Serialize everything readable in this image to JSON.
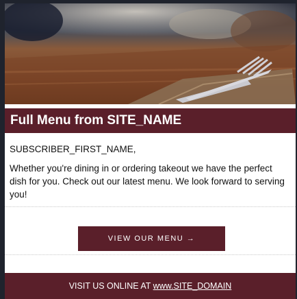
{
  "email": {
    "hero": {
      "alt": "table with fork and knife on napkin"
    },
    "banner_title": "Full Menu from SITE_NAME",
    "greeting": "SUBSCRIBER_FIRST_NAME,",
    "body": "Whether you're dining in or ordering takeout we have the perfect dish for you. Check out our latest menu. We look forward to serving you!",
    "cta_label": "VIEW OUR MENU →",
    "footer": {
      "prefix": "VISIT US ONLINE AT ",
      "link": "www.SITE_DOMAIN"
    }
  },
  "colors": {
    "brand": "#5a1f2a",
    "background": "#1f232d"
  }
}
